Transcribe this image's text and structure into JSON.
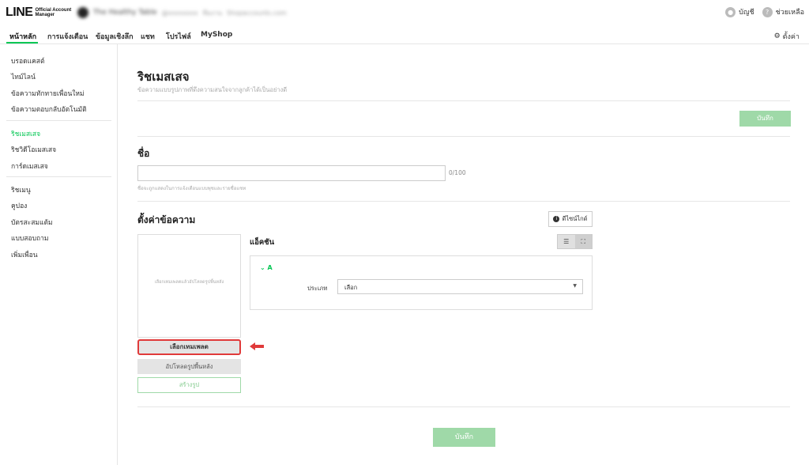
{
  "header": {
    "logo_text": "LINE",
    "logo_sub_1": "Official Account",
    "logo_sub_2": "Manager",
    "account_name": "The Healthy Table",
    "account_id": "@xxxxxxxx",
    "account_extra": "ทีมงาน",
    "account_extra2": "Shopaccounts.com",
    "account_label": "บัญชี",
    "help_label": "ช่วยเหลือ"
  },
  "nav": {
    "tabs": [
      "หน้าหลัก",
      "การแจ้งเตือน",
      "ข้อมูลเชิงลึก",
      "แชท",
      "โปรไฟล์",
      "MyShop"
    ],
    "settings_label": "ตั้งค่า"
  },
  "sidebar": {
    "group1": [
      "บรอดแคสต์",
      "ไทม์ไลน์",
      "ข้อความทักทายเพื่อนใหม่",
      "ข้อความตอบกลับอัตโนมัติ"
    ],
    "group2": [
      "ริชเมสเสจ",
      "ริชวิดีโอเมสเสจ",
      "การ์ดเมสเสจ"
    ],
    "group3": [
      "ริชเมนู",
      "คูปอง",
      "บัตรสะสมแต้ม",
      "แบบสอบถาม",
      "เพิ่มเพื่อน"
    ]
  },
  "main": {
    "title": "ริชเมสเสจ",
    "subtitle": "ข้อความแบบรูปภาพที่ดึงความสนใจจากลูกค้าได้เป็นอย่างดี",
    "save_top": "บันทึก",
    "name_section": "ชื่อ",
    "name_value": "",
    "char_count": "0/100",
    "name_help": "ชื่อจะถูกแสดงในการแจ้งเตือนแบบพุชและรายชื่อแชท",
    "settings_section": "ตั้งค่าข้อความ",
    "guide_label": "ดีไซน์ไกด์",
    "preview_hint": "เลือกเทมเพลตแล้วอัปโหลดรูปพื้นหลัง",
    "select_template": "เลือกเทมเพลต",
    "upload_bg": "อัปโหลดรูปพื้นหลัง",
    "create_image": "สร้างรูป",
    "action_title": "แอ็คชัน",
    "action_item": "A",
    "type_label": "ประเภท",
    "type_value": "เลือก",
    "save_bottom": "บันทึก"
  },
  "colors": {
    "accent": "#06c755",
    "button_disabled": "#9fd9a8",
    "highlight": "#e03a3a"
  }
}
